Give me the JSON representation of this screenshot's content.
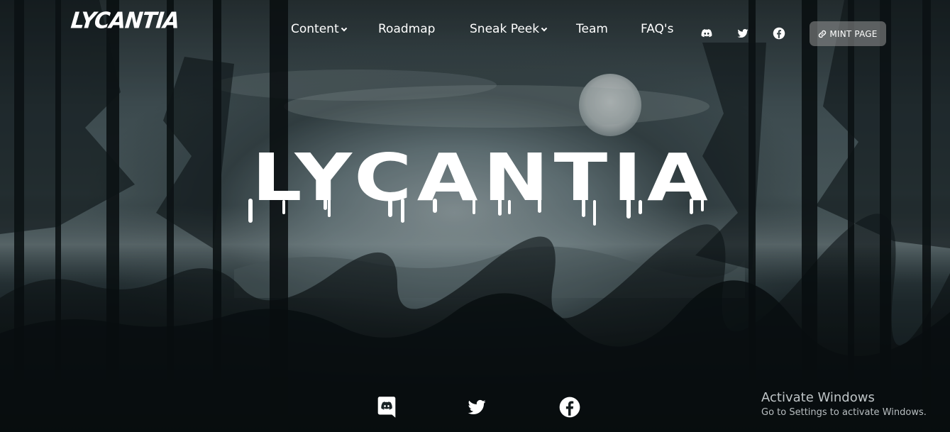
{
  "brand": {
    "logo_text": "LYCANTIA"
  },
  "nav": {
    "items": [
      {
        "label": "Content",
        "has_dropdown": true
      },
      {
        "label": "Roadmap",
        "has_dropdown": false
      },
      {
        "label": "Sneak Peek",
        "has_dropdown": true
      },
      {
        "label": "Team",
        "has_dropdown": false
      },
      {
        "label": "FAQ's",
        "has_dropdown": false
      }
    ],
    "social_icons": [
      "discord-icon",
      "twitter-icon",
      "facebook-icon"
    ],
    "mint_button": {
      "label": "MINT PAGE",
      "icon": "link-icon"
    }
  },
  "hero": {
    "title": "LYCANTIA"
  },
  "footer": {
    "social_icons": [
      "discord-icon",
      "twitter-icon",
      "facebook-icon"
    ]
  },
  "os_watermark": {
    "title": "Activate Windows",
    "subtitle": "Go to Settings to activate Windows."
  },
  "colors": {
    "text": "#ffffff",
    "button_bg": "#8c8c8c",
    "sky": "#9aa9ad",
    "forest": "#0d1416"
  }
}
